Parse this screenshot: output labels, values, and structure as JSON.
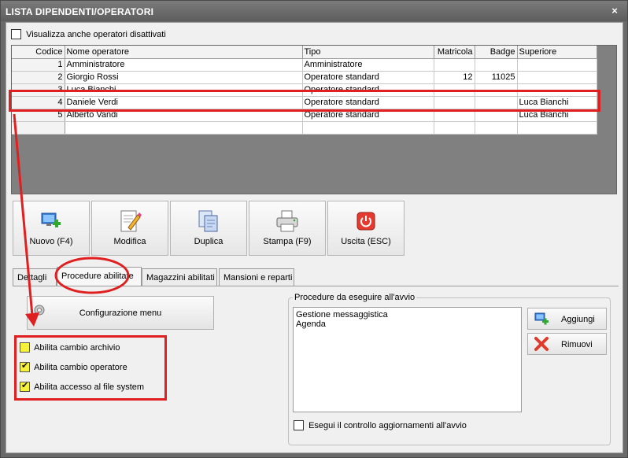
{
  "window": {
    "title": "LISTA DIPENDENTI/OPERATORI",
    "close_glyph": "×"
  },
  "show_inactive": {
    "label": "Visualizza anche operatori disattivati",
    "checked": false
  },
  "grid": {
    "columns": [
      "Codice",
      "Nome operatore",
      "Tipo",
      "Matricola",
      "Badge",
      "Superiore"
    ],
    "rows": [
      {
        "codice": "1",
        "nome": "Amministratore",
        "tipo": "Amministratore",
        "matricola": "",
        "badge": "",
        "superiore": ""
      },
      {
        "codice": "2",
        "nome": "Giorgio Rossi",
        "tipo": "Operatore standard",
        "matricola": "12",
        "badge": "11025",
        "superiore": ""
      },
      {
        "codice": "3",
        "nome": "Luca Bianchi",
        "tipo": "Operatore standard",
        "matricola": "",
        "badge": "",
        "superiore": ""
      },
      {
        "codice": "4",
        "nome": "Daniele Verdi",
        "tipo": "Operatore standard",
        "matricola": "",
        "badge": "",
        "superiore": "Luca Bianchi"
      },
      {
        "codice": "5",
        "nome": "Alberto Vandi",
        "tipo": "Operatore standard",
        "matricola": "",
        "badge": "",
        "superiore": "Luca Bianchi"
      }
    ]
  },
  "toolbar": {
    "new": "Nuovo (F4)",
    "edit": "Modifica",
    "duplicate": "Duplica",
    "print": "Stampa (F9)",
    "exit": "Uscita (ESC)"
  },
  "tabs": [
    "Dettagli",
    "Procedure abilitate",
    "Magazzini abilitati",
    "Mansioni e reparti"
  ],
  "procedures_tab": {
    "config_menu_label": "Configurazione menu",
    "permissions": [
      {
        "label": "Abilita cambio archivio",
        "checked": false
      },
      {
        "label": "Abilita cambio operatore",
        "checked": true
      },
      {
        "label": "Abilita accesso al file system",
        "checked": true
      }
    ],
    "startup": {
      "legend": "Procedure da eseguire all'avvio",
      "items": [
        "Gestione messaggistica",
        "Agenda"
      ],
      "add_label": "Aggiungi",
      "remove_label": "Rimuovi",
      "update_check_label": "Esegui il controllo aggiornamenti all'avvio",
      "update_check": false
    }
  },
  "colors": {
    "annotation": "#e02020",
    "accent_checkbox": "#f6f13a"
  }
}
